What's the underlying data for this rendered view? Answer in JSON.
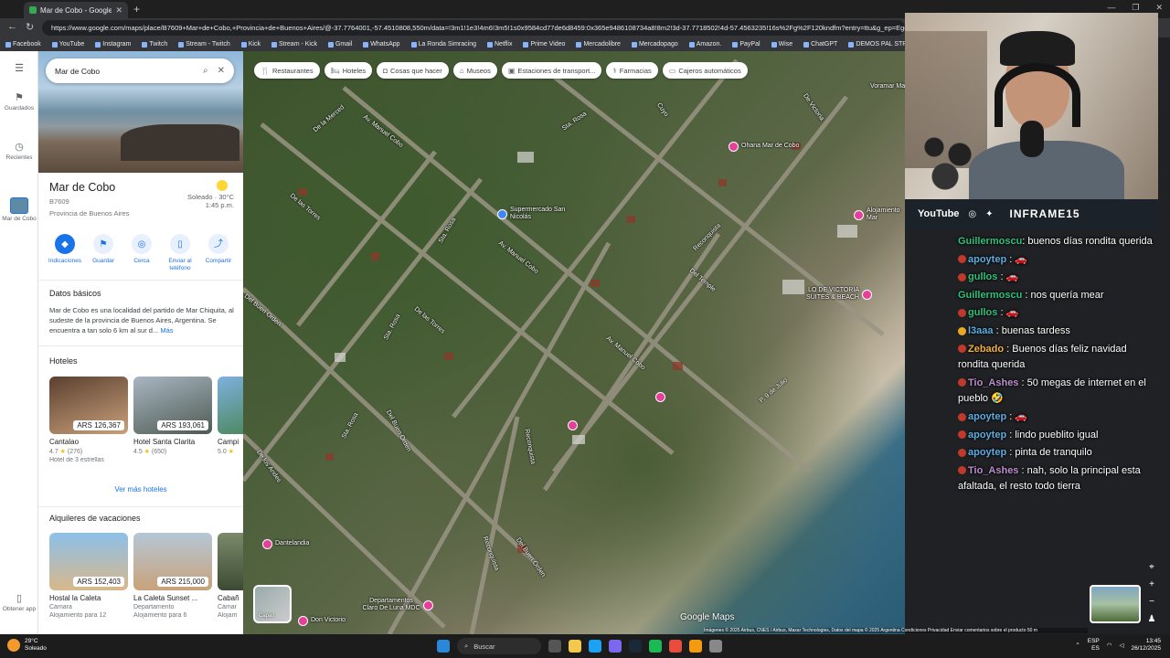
{
  "browser": {
    "tab_title": "Mar de Cobo - Google Maps",
    "url": "https://www.google.com/maps/place/B7609+Mar+de+Cobo,+Provincia+de+Buenos+Aires/@-37.7764001,-57.4510808,550m/data=!3m1!1e3!4m6!3m5!1s0x9584cd77de6d8459:0x365e9486108734a8!8m2!3d-37.7718502!4d-57.4563235!16s%2Fg%2F120kndfm?entry=ttu&g_ep=EgoyMDI1MTIwOS4wIKXMDSoASAFQAw%3D%3D",
    "bookmarks": [
      "Facebook",
      "YouTube",
      "Instagram",
      "Twitch",
      "Stream - Twitch",
      "Kick",
      "Stream - Kick",
      "Gmail",
      "WhatsApp",
      "La Ronda Simracing",
      "Netflix",
      "Prime Video",
      "Mercadolibre",
      "Mercadopago",
      "Amazon.",
      "PayPal",
      "Wise",
      "ChatGPT",
      "DEMOS PAL STREA..."
    ]
  },
  "rail": {
    "saved": "Guardados",
    "recent": "Recientes",
    "current": "Mar de Cobo",
    "get_app": "Obtener app"
  },
  "panel": {
    "search_value": "Mar de Cobo",
    "title": "Mar de Cobo",
    "postal_code": "B7609",
    "region": "Provincia de Buenos Aires",
    "weather_line1": "Soleado · 30°C",
    "weather_line2": "1:45 p.m.",
    "actions": [
      "Indicaciones",
      "Guardar",
      "Cerca",
      "Enviar al teléfono",
      "Compartir"
    ],
    "basics_title": "Datos básicos",
    "basics_text": "Mar de Cobo es una localidad del partido de Mar Chiquita, al sudeste de la provincia de Buenos Aires, Argentina. Se encuentra a tan solo 6 km al sur d... ",
    "basics_more": "Más",
    "hotels_title": "Hoteles",
    "hotels": [
      {
        "name": "Cantalao",
        "price": "ARS 126,367",
        "rating": "4.7",
        "reviews": "(276)",
        "sub": "Hotel de 3 estrellas"
      },
      {
        "name": "Hotel Santa Clarita",
        "price": "ARS 193,061",
        "rating": "4.5",
        "reviews": "(650)",
        "sub": ""
      },
      {
        "name": "Campi",
        "price": "",
        "rating": "5.0",
        "reviews": "",
        "sub": ""
      }
    ],
    "see_more_hotels": "Ver más hoteles",
    "rentals_title": "Alquileres de vacaciones",
    "rentals": [
      {
        "name": "Hostal la Caleta",
        "price": "ARS 152,403",
        "type": "Cámara",
        "sub": "Alojamiento para 12"
      },
      {
        "name": "La Caleta Sunset ...",
        "price": "ARS 215,000",
        "type": "Departamento",
        "sub": "Alojamiento para 6"
      },
      {
        "name": "Cabañ",
        "price": "",
        "type": "Cámar",
        "sub": "Alojam"
      }
    ]
  },
  "map": {
    "chips": [
      "Restaurantes",
      "Hoteles",
      "Cosas que hacer",
      "Museos",
      "Estaciones de transport...",
      "Farmacias",
      "Cajeros automáticos"
    ],
    "streets": [
      "De la Merced",
      "Av. Manuel Cobo",
      "Sta. Rosa",
      "Cuyo",
      "De Victoria",
      "De las Torres",
      "Reconquista",
      "Del Temple",
      "Sta. Rosa",
      "Av. Manuel Cobo",
      "Del Buen Orden",
      "Sta. Rosa",
      "De las Torres",
      "Av. Manuel Cobo",
      "P. 9 de Julio",
      "Del Buen Orden",
      "Sta. Rosa",
      "Reconquista",
      "De los Andes",
      "Del Buen Orden",
      "Reconquista",
      "Voramar Ma"
    ],
    "pois": [
      "Supermercado San Nicolás",
      "Ohana Mar de Cobo",
      "Alojamiento Mar",
      "LO DE VICTORIA SUITES & BEACH",
      "Dantelandia",
      "Departamentos Claro De Luna MDC",
      "Don Victorio"
    ],
    "layers_label": "Capas",
    "logo": "Google Maps",
    "attribution": "Imágenes © 2025 Airbus, CNES / Airbus, Maxar Technologies, Datos del mapa © 2025   Argentina   Condiciones   Privacidad   Enviar comentarios sobre el producto   50 m"
  },
  "stream": {
    "social_youtube": "YouTube",
    "handle": "INFRAME15",
    "chat": [
      {
        "user": "Guillermoscu",
        "color": "#2ec27e",
        "text": ": buenos días rondita querida",
        "badge": ""
      },
      {
        "user": "apoytep",
        "color": "#5dade2",
        "text": " : 🚗",
        "badge": "red"
      },
      {
        "user": "gullos",
        "color": "#2ec27e",
        "text": " : 🚗",
        "badge": "red"
      },
      {
        "user": "Guillermoscu",
        "color": "#2ec27e",
        "text": " : nos quería mear",
        "badge": ""
      },
      {
        "user": "gullos",
        "color": "#2ec27e",
        "text": " : 🚗",
        "badge": "red"
      },
      {
        "user": "l3aaa",
        "color": "#5dade2",
        "text": " : buenas tardess",
        "badge": "gold"
      },
      {
        "user": "Zebado",
        "color": "#f5b041",
        "text": " : Buenos días feliz navidad rondita querida",
        "badge": "red"
      },
      {
        "user": "Tio_Ashes",
        "color": "#bb8fce",
        "text": " : 50 megas de internet en el pueblo 🤣",
        "badge": "red"
      },
      {
        "user": "apoytep",
        "color": "#5dade2",
        "text": " : 🚗",
        "badge": "red"
      },
      {
        "user": "apoytep",
        "color": "#5dade2",
        "text": " : lindo pueblito igual",
        "badge": "red"
      },
      {
        "user": "apoytep",
        "color": "#5dade2",
        "text": " : pinta de tranquilo",
        "badge": "red"
      },
      {
        "user": "Tio_Ashes",
        "color": "#bb8fce",
        "text": " : nah, solo la principal esta afaltada, el resto todo tierra",
        "badge": "red"
      }
    ]
  },
  "taskbar": {
    "temp": "29°C",
    "condition": "Soleado",
    "search": "Buscar",
    "lang1": "ESP",
    "lang2": "ES",
    "time": "13:45",
    "date": "26/12/2025"
  }
}
